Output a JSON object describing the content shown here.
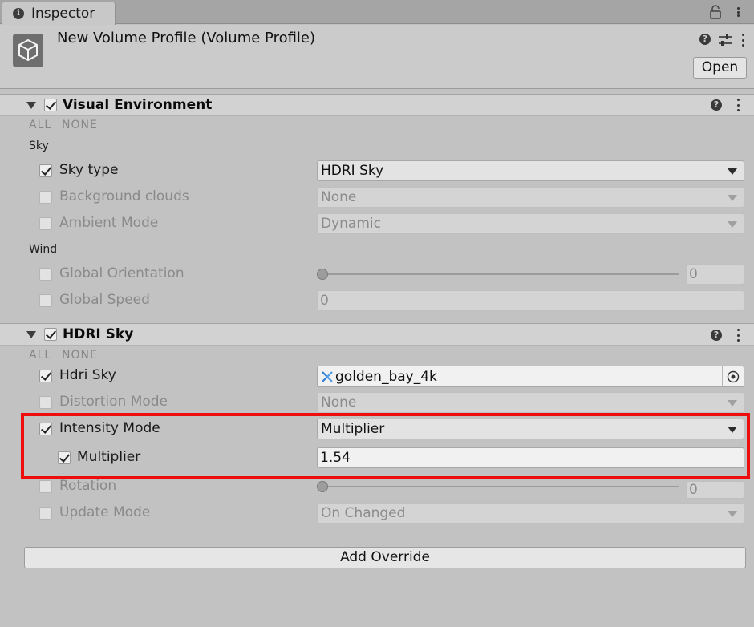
{
  "tab": {
    "label": "Inspector"
  },
  "header": {
    "title": "New Volume Profile (Volume Profile)",
    "open_label": "Open"
  },
  "sections": {
    "visual_environment": {
      "title": "Visual Environment",
      "enabled": true,
      "all_label": "ALL",
      "none_label": "NONE",
      "groups": {
        "sky_label": "Sky",
        "wind_label": "Wind"
      },
      "sky_type": {
        "label": "Sky type",
        "overridden": true,
        "value": "HDRI Sky"
      },
      "background_clouds": {
        "label": "Background clouds",
        "overridden": false,
        "value": "None"
      },
      "ambient_mode": {
        "label": "Ambient Mode",
        "overridden": false,
        "value": "Dynamic"
      },
      "global_orientation": {
        "label": "Global Orientation",
        "overridden": false,
        "value": "0",
        "slider_fraction": 0.0
      },
      "global_speed": {
        "label": "Global Speed",
        "overridden": false,
        "value": "0"
      }
    },
    "hdri_sky": {
      "title": "HDRI Sky",
      "enabled": true,
      "all_label": "ALL",
      "none_label": "NONE",
      "hdri_sky": {
        "label": "Hdri Sky",
        "overridden": true,
        "value": "golden_bay_4k"
      },
      "distortion_mode": {
        "label": "Distortion Mode",
        "overridden": false,
        "value": "None"
      },
      "intensity_mode": {
        "label": "Intensity Mode",
        "overridden": true,
        "value": "Multiplier"
      },
      "multiplier": {
        "label": "Multiplier",
        "overridden": true,
        "value": "1.54"
      },
      "rotation": {
        "label": "Rotation",
        "overridden": false,
        "value": "0",
        "slider_fraction": 0.0
      },
      "update_mode": {
        "label": "Update Mode",
        "overridden": false,
        "value": "On Changed"
      }
    }
  },
  "footer": {
    "add_override_label": "Add Override"
  },
  "colors": {
    "highlight": "#ee0c0c",
    "panel_bg": "#c2c2c2"
  },
  "icons": [
    "info-icon",
    "lock-icon",
    "menu-icon",
    "asset-icon",
    "help-icon",
    "presets-icon",
    "more-icon",
    "foldout-arrow-icon",
    "checkbox-icon",
    "dropdown-arrow-icon",
    "cubemap-icon",
    "object-picker-icon"
  ]
}
